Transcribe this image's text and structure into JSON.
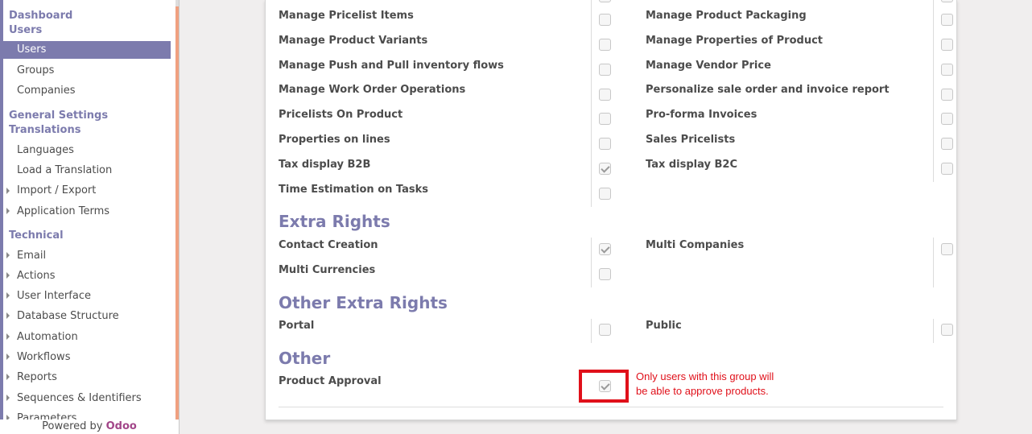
{
  "sidebar": {
    "dashboard": "Dashboard",
    "users": "Users",
    "items_users": [
      "Users",
      "Groups",
      "Companies"
    ],
    "general_settings": "General Settings",
    "translations": "Translations",
    "items_translations": [
      "Languages",
      "Load a Translation",
      "Import / Export",
      "Application Terms"
    ],
    "technical": "Technical",
    "items_technical": [
      "Email",
      "Actions",
      "User Interface",
      "Database Structure",
      "Automation",
      "Workflows",
      "Reports",
      "Sequences & Identifiers",
      "Parameters"
    ],
    "powered_prefix": "Powered by",
    "powered_brand": "Odoo"
  },
  "rights": {
    "left": [
      {
        "label": "Manage Pricelist Items",
        "checked": false
      },
      {
        "label": "Manage Product Variants",
        "checked": false
      },
      {
        "label": "Manage Push and Pull inventory flows",
        "checked": false
      },
      {
        "label": "Manage Work Order Operations",
        "checked": false
      },
      {
        "label": "Pricelists On Product",
        "checked": false
      },
      {
        "label": "Properties on lines",
        "checked": false
      },
      {
        "label": "Tax display B2B",
        "checked": true
      },
      {
        "label": "Time Estimation on Tasks",
        "checked": false
      }
    ],
    "right": [
      {
        "label": "Manage Product Packaging",
        "checked": false
      },
      {
        "label": "Manage Properties of Product",
        "checked": false
      },
      {
        "label": "Manage Vendor Price",
        "checked": false
      },
      {
        "label": "Personalize sale order and invoice report",
        "checked": false
      },
      {
        "label": "Pro-forma Invoices",
        "checked": false
      },
      {
        "label": "Sales Pricelists",
        "checked": false
      },
      {
        "label": "Tax display B2C",
        "checked": false
      }
    ]
  },
  "extra_rights": {
    "title": "Extra Rights",
    "contact_creation": "Contact Creation",
    "multi_companies": "Multi Companies",
    "multi_currencies": "Multi Currencies"
  },
  "other_extra_rights": {
    "title": "Other Extra Rights",
    "portal": "Portal",
    "public": "Public"
  },
  "other": {
    "title": "Other",
    "product_approval": "Product Approval",
    "product_approval_checked": true
  },
  "annotation": {
    "line1": "Only users with this group will",
    "line2": "be able to approve products.",
    "color": "#e0101a"
  },
  "colors": {
    "accent": "#7c7bad",
    "brand": "#a24689"
  }
}
